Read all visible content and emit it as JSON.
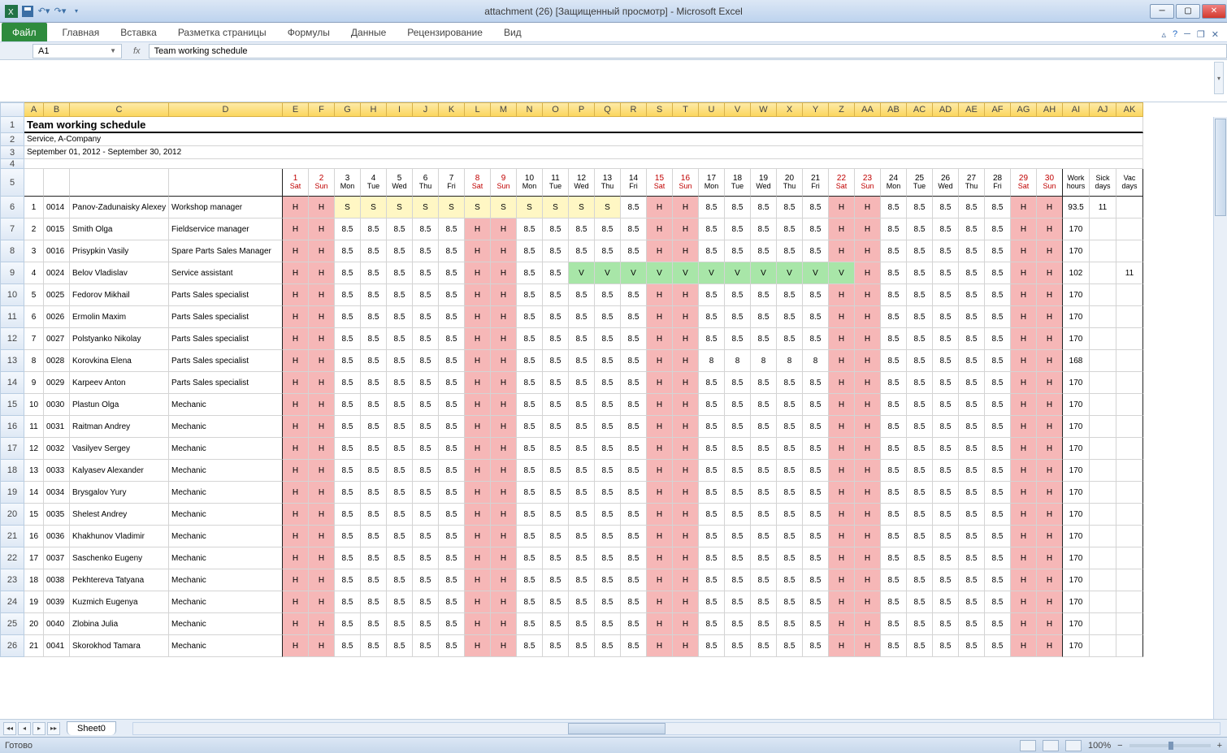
{
  "window": {
    "title": "attachment (26)  [Защищенный просмотр]  -  Microsoft Excel"
  },
  "ribbon": {
    "file": "Файл",
    "tabs": [
      "Главная",
      "Вставка",
      "Разметка страницы",
      "Формулы",
      "Данные",
      "Рецензирование",
      "Вид"
    ]
  },
  "namebox": "A1",
  "formula_value": "Team working schedule",
  "sheet_tab": "Sheet0",
  "status": {
    "ready": "Готово",
    "zoom": "100%"
  },
  "zoom_buttons": {
    "minus": "−",
    "plus": "+"
  },
  "col_widths": {
    "A": 24,
    "B": 32,
    "C": 122,
    "D": 140,
    "day": 32,
    "summary": 33
  },
  "col_letters": [
    "A",
    "B",
    "C",
    "D",
    "E",
    "F",
    "G",
    "H",
    "I",
    "J",
    "K",
    "L",
    "M",
    "N",
    "O",
    "P",
    "Q",
    "R",
    "S",
    "T",
    "U",
    "V",
    "W",
    "X",
    "Y",
    "Z",
    "AA",
    "AB",
    "AC",
    "AD",
    "AE",
    "AF",
    "AG",
    "AH",
    "AI",
    "AJ",
    "AK"
  ],
  "title_row": "Team working schedule",
  "subtitle": "Service, A-Company",
  "daterange": "September 01, 2012 - September 30, 2012",
  "days": [
    {
      "n": "1",
      "w": "Sat",
      "we": true
    },
    {
      "n": "2",
      "w": "Sun",
      "we": true
    },
    {
      "n": "3",
      "w": "Mon"
    },
    {
      "n": "4",
      "w": "Tue"
    },
    {
      "n": "5",
      "w": "Wed"
    },
    {
      "n": "6",
      "w": "Thu"
    },
    {
      "n": "7",
      "w": "Fri"
    },
    {
      "n": "8",
      "w": "Sat",
      "we": true
    },
    {
      "n": "9",
      "w": "Sun",
      "we": true
    },
    {
      "n": "10",
      "w": "Mon"
    },
    {
      "n": "11",
      "w": "Tue"
    },
    {
      "n": "12",
      "w": "Wed"
    },
    {
      "n": "13",
      "w": "Thu"
    },
    {
      "n": "14",
      "w": "Fri"
    },
    {
      "n": "15",
      "w": "Sat",
      "we": true
    },
    {
      "n": "16",
      "w": "Sun",
      "we": true
    },
    {
      "n": "17",
      "w": "Mon"
    },
    {
      "n": "18",
      "w": "Tue"
    },
    {
      "n": "19",
      "w": "Wed"
    },
    {
      "n": "20",
      "w": "Thu"
    },
    {
      "n": "21",
      "w": "Fri"
    },
    {
      "n": "22",
      "w": "Sat",
      "we": true
    },
    {
      "n": "23",
      "w": "Sun",
      "we": true
    },
    {
      "n": "24",
      "w": "Mon"
    },
    {
      "n": "25",
      "w": "Tue"
    },
    {
      "n": "26",
      "w": "Wed"
    },
    {
      "n": "27",
      "w": "Thu"
    },
    {
      "n": "28",
      "w": "Fri"
    },
    {
      "n": "29",
      "w": "Sat",
      "we": true
    },
    {
      "n": "30",
      "w": "Sun",
      "we": true
    }
  ],
  "summary_heads": [
    "Work\nhours",
    "Sick\ndays",
    "Vac\ndays"
  ],
  "rows": [
    {
      "idx": "1",
      "code": "0014",
      "name": "Panov-Zadunaisky Alexey",
      "role": "Workshop manager",
      "d": [
        "H",
        "H",
        "S",
        "S",
        "S",
        "S",
        "S",
        "S",
        "S",
        "S",
        "S",
        "S",
        "S",
        "8.5",
        "H",
        "H",
        "8.5",
        "8.5",
        "8.5",
        "8.5",
        "8.5",
        "H",
        "H",
        "8.5",
        "8.5",
        "8.5",
        "8.5",
        "8.5",
        "H",
        "H"
      ],
      "sum": [
        "93.5",
        "11",
        ""
      ]
    },
    {
      "idx": "2",
      "code": "0015",
      "name": "Smith Olga",
      "role": "Fieldservice manager",
      "d": [
        "H",
        "H",
        "8.5",
        "8.5",
        "8.5",
        "8.5",
        "8.5",
        "H",
        "H",
        "8.5",
        "8.5",
        "8.5",
        "8.5",
        "8.5",
        "H",
        "H",
        "8.5",
        "8.5",
        "8.5",
        "8.5",
        "8.5",
        "H",
        "H",
        "8.5",
        "8.5",
        "8.5",
        "8.5",
        "8.5",
        "H",
        "H"
      ],
      "sum": [
        "170",
        "",
        ""
      ]
    },
    {
      "idx": "3",
      "code": "0016",
      "name": "Prisypkin Vasily",
      "role": "Spare Parts Sales Manager",
      "d": [
        "H",
        "H",
        "8.5",
        "8.5",
        "8.5",
        "8.5",
        "8.5",
        "H",
        "H",
        "8.5",
        "8.5",
        "8.5",
        "8.5",
        "8.5",
        "H",
        "H",
        "8.5",
        "8.5",
        "8.5",
        "8.5",
        "8.5",
        "H",
        "H",
        "8.5",
        "8.5",
        "8.5",
        "8.5",
        "8.5",
        "H",
        "H"
      ],
      "sum": [
        "170",
        "",
        ""
      ]
    },
    {
      "idx": "4",
      "code": "0024",
      "name": "Belov Vladislav",
      "role": "Service assistant",
      "d": [
        "H",
        "H",
        "8.5",
        "8.5",
        "8.5",
        "8.5",
        "8.5",
        "H",
        "H",
        "8.5",
        "8.5",
        "V",
        "V",
        "V",
        "V",
        "V",
        "V",
        "V",
        "V",
        "V",
        "V",
        "V",
        "H",
        "8.5",
        "8.5",
        "8.5",
        "8.5",
        "8.5",
        "H",
        "H"
      ],
      "sum": [
        "102",
        "",
        "11"
      ]
    },
    {
      "idx": "5",
      "code": "0025",
      "name": "Fedorov Mikhail",
      "role": "Parts Sales specialist",
      "d": [
        "H",
        "H",
        "8.5",
        "8.5",
        "8.5",
        "8.5",
        "8.5",
        "H",
        "H",
        "8.5",
        "8.5",
        "8.5",
        "8.5",
        "8.5",
        "H",
        "H",
        "8.5",
        "8.5",
        "8.5",
        "8.5",
        "8.5",
        "H",
        "H",
        "8.5",
        "8.5",
        "8.5",
        "8.5",
        "8.5",
        "H",
        "H"
      ],
      "sum": [
        "170",
        "",
        ""
      ]
    },
    {
      "idx": "6",
      "code": "0026",
      "name": "Ermolin Maxim",
      "role": "Parts Sales specialist",
      "d": [
        "H",
        "H",
        "8.5",
        "8.5",
        "8.5",
        "8.5",
        "8.5",
        "H",
        "H",
        "8.5",
        "8.5",
        "8.5",
        "8.5",
        "8.5",
        "H",
        "H",
        "8.5",
        "8.5",
        "8.5",
        "8.5",
        "8.5",
        "H",
        "H",
        "8.5",
        "8.5",
        "8.5",
        "8.5",
        "8.5",
        "H",
        "H"
      ],
      "sum": [
        "170",
        "",
        ""
      ]
    },
    {
      "idx": "7",
      "code": "0027",
      "name": "Polstyanko Nikolay",
      "role": "Parts Sales specialist",
      "d": [
        "H",
        "H",
        "8.5",
        "8.5",
        "8.5",
        "8.5",
        "8.5",
        "H",
        "H",
        "8.5",
        "8.5",
        "8.5",
        "8.5",
        "8.5",
        "H",
        "H",
        "8.5",
        "8.5",
        "8.5",
        "8.5",
        "8.5",
        "H",
        "H",
        "8.5",
        "8.5",
        "8.5",
        "8.5",
        "8.5",
        "H",
        "H"
      ],
      "sum": [
        "170",
        "",
        ""
      ]
    },
    {
      "idx": "8",
      "code": "0028",
      "name": "Korovkina Elena",
      "role": "Parts Sales specialist",
      "d": [
        "H",
        "H",
        "8.5",
        "8.5",
        "8.5",
        "8.5",
        "8.5",
        "H",
        "H",
        "8.5",
        "8.5",
        "8.5",
        "8.5",
        "8.5",
        "H",
        "H",
        "8",
        "8",
        "8",
        "8",
        "8",
        "H",
        "H",
        "8.5",
        "8.5",
        "8.5",
        "8.5",
        "8.5",
        "H",
        "H"
      ],
      "sum": [
        "168",
        "",
        ""
      ]
    },
    {
      "idx": "9",
      "code": "0029",
      "name": "Karpeev Anton",
      "role": "Parts Sales specialist",
      "d": [
        "H",
        "H",
        "8.5",
        "8.5",
        "8.5",
        "8.5",
        "8.5",
        "H",
        "H",
        "8.5",
        "8.5",
        "8.5",
        "8.5",
        "8.5",
        "H",
        "H",
        "8.5",
        "8.5",
        "8.5",
        "8.5",
        "8.5",
        "H",
        "H",
        "8.5",
        "8.5",
        "8.5",
        "8.5",
        "8.5",
        "H",
        "H"
      ],
      "sum": [
        "170",
        "",
        ""
      ]
    },
    {
      "idx": "10",
      "code": "0030",
      "name": "Plastun Olga",
      "role": "Mechanic",
      "d": [
        "H",
        "H",
        "8.5",
        "8.5",
        "8.5",
        "8.5",
        "8.5",
        "H",
        "H",
        "8.5",
        "8.5",
        "8.5",
        "8.5",
        "8.5",
        "H",
        "H",
        "8.5",
        "8.5",
        "8.5",
        "8.5",
        "8.5",
        "H",
        "H",
        "8.5",
        "8.5",
        "8.5",
        "8.5",
        "8.5",
        "H",
        "H"
      ],
      "sum": [
        "170",
        "",
        ""
      ]
    },
    {
      "idx": "11",
      "code": "0031",
      "name": "Raitman Andrey",
      "role": "Mechanic",
      "d": [
        "H",
        "H",
        "8.5",
        "8.5",
        "8.5",
        "8.5",
        "8.5",
        "H",
        "H",
        "8.5",
        "8.5",
        "8.5",
        "8.5",
        "8.5",
        "H",
        "H",
        "8.5",
        "8.5",
        "8.5",
        "8.5",
        "8.5",
        "H",
        "H",
        "8.5",
        "8.5",
        "8.5",
        "8.5",
        "8.5",
        "H",
        "H"
      ],
      "sum": [
        "170",
        "",
        ""
      ]
    },
    {
      "idx": "12",
      "code": "0032",
      "name": "Vasilyev Sergey",
      "role": "Mechanic",
      "d": [
        "H",
        "H",
        "8.5",
        "8.5",
        "8.5",
        "8.5",
        "8.5",
        "H",
        "H",
        "8.5",
        "8.5",
        "8.5",
        "8.5",
        "8.5",
        "H",
        "H",
        "8.5",
        "8.5",
        "8.5",
        "8.5",
        "8.5",
        "H",
        "H",
        "8.5",
        "8.5",
        "8.5",
        "8.5",
        "8.5",
        "H",
        "H"
      ],
      "sum": [
        "170",
        "",
        ""
      ]
    },
    {
      "idx": "13",
      "code": "0033",
      "name": "Kalyasev Alexander",
      "role": "Mechanic",
      "d": [
        "H",
        "H",
        "8.5",
        "8.5",
        "8.5",
        "8.5",
        "8.5",
        "H",
        "H",
        "8.5",
        "8.5",
        "8.5",
        "8.5",
        "8.5",
        "H",
        "H",
        "8.5",
        "8.5",
        "8.5",
        "8.5",
        "8.5",
        "H",
        "H",
        "8.5",
        "8.5",
        "8.5",
        "8.5",
        "8.5",
        "H",
        "H"
      ],
      "sum": [
        "170",
        "",
        ""
      ]
    },
    {
      "idx": "14",
      "code": "0034",
      "name": "Brysgalov Yury",
      "role": "Mechanic",
      "d": [
        "H",
        "H",
        "8.5",
        "8.5",
        "8.5",
        "8.5",
        "8.5",
        "H",
        "H",
        "8.5",
        "8.5",
        "8.5",
        "8.5",
        "8.5",
        "H",
        "H",
        "8.5",
        "8.5",
        "8.5",
        "8.5",
        "8.5",
        "H",
        "H",
        "8.5",
        "8.5",
        "8.5",
        "8.5",
        "8.5",
        "H",
        "H"
      ],
      "sum": [
        "170",
        "",
        ""
      ]
    },
    {
      "idx": "15",
      "code": "0035",
      "name": "Shelest Andrey",
      "role": "Mechanic",
      "d": [
        "H",
        "H",
        "8.5",
        "8.5",
        "8.5",
        "8.5",
        "8.5",
        "H",
        "H",
        "8.5",
        "8.5",
        "8.5",
        "8.5",
        "8.5",
        "H",
        "H",
        "8.5",
        "8.5",
        "8.5",
        "8.5",
        "8.5",
        "H",
        "H",
        "8.5",
        "8.5",
        "8.5",
        "8.5",
        "8.5",
        "H",
        "H"
      ],
      "sum": [
        "170",
        "",
        ""
      ]
    },
    {
      "idx": "16",
      "code": "0036",
      "name": "Khakhunov Vladimir",
      "role": "Mechanic",
      "d": [
        "H",
        "H",
        "8.5",
        "8.5",
        "8.5",
        "8.5",
        "8.5",
        "H",
        "H",
        "8.5",
        "8.5",
        "8.5",
        "8.5",
        "8.5",
        "H",
        "H",
        "8.5",
        "8.5",
        "8.5",
        "8.5",
        "8.5",
        "H",
        "H",
        "8.5",
        "8.5",
        "8.5",
        "8.5",
        "8.5",
        "H",
        "H"
      ],
      "sum": [
        "170",
        "",
        ""
      ]
    },
    {
      "idx": "17",
      "code": "0037",
      "name": "Saschenko Eugeny",
      "role": "Mechanic",
      "d": [
        "H",
        "H",
        "8.5",
        "8.5",
        "8.5",
        "8.5",
        "8.5",
        "H",
        "H",
        "8.5",
        "8.5",
        "8.5",
        "8.5",
        "8.5",
        "H",
        "H",
        "8.5",
        "8.5",
        "8.5",
        "8.5",
        "8.5",
        "H",
        "H",
        "8.5",
        "8.5",
        "8.5",
        "8.5",
        "8.5",
        "H",
        "H"
      ],
      "sum": [
        "170",
        "",
        ""
      ]
    },
    {
      "idx": "18",
      "code": "0038",
      "name": "Pekhtereva Tatyana",
      "role": "Mechanic",
      "d": [
        "H",
        "H",
        "8.5",
        "8.5",
        "8.5",
        "8.5",
        "8.5",
        "H",
        "H",
        "8.5",
        "8.5",
        "8.5",
        "8.5",
        "8.5",
        "H",
        "H",
        "8.5",
        "8.5",
        "8.5",
        "8.5",
        "8.5",
        "H",
        "H",
        "8.5",
        "8.5",
        "8.5",
        "8.5",
        "8.5",
        "H",
        "H"
      ],
      "sum": [
        "170",
        "",
        ""
      ]
    },
    {
      "idx": "19",
      "code": "0039",
      "name": "Kuzmich Eugenya",
      "role": "Mechanic",
      "d": [
        "H",
        "H",
        "8.5",
        "8.5",
        "8.5",
        "8.5",
        "8.5",
        "H",
        "H",
        "8.5",
        "8.5",
        "8.5",
        "8.5",
        "8.5",
        "H",
        "H",
        "8.5",
        "8.5",
        "8.5",
        "8.5",
        "8.5",
        "H",
        "H",
        "8.5",
        "8.5",
        "8.5",
        "8.5",
        "8.5",
        "H",
        "H"
      ],
      "sum": [
        "170",
        "",
        ""
      ]
    },
    {
      "idx": "20",
      "code": "0040",
      "name": "Zlobina Julia",
      "role": "Mechanic",
      "d": [
        "H",
        "H",
        "8.5",
        "8.5",
        "8.5",
        "8.5",
        "8.5",
        "H",
        "H",
        "8.5",
        "8.5",
        "8.5",
        "8.5",
        "8.5",
        "H",
        "H",
        "8.5",
        "8.5",
        "8.5",
        "8.5",
        "8.5",
        "H",
        "H",
        "8.5",
        "8.5",
        "8.5",
        "8.5",
        "8.5",
        "H",
        "H"
      ],
      "sum": [
        "170",
        "",
        ""
      ]
    },
    {
      "idx": "21",
      "code": "0041",
      "name": "Skorokhod Tamara",
      "role": "Mechanic",
      "d": [
        "H",
        "H",
        "8.5",
        "8.5",
        "8.5",
        "8.5",
        "8.5",
        "H",
        "H",
        "8.5",
        "8.5",
        "8.5",
        "8.5",
        "8.5",
        "H",
        "H",
        "8.5",
        "8.5",
        "8.5",
        "8.5",
        "8.5",
        "H",
        "H",
        "8.5",
        "8.5",
        "8.5",
        "8.5",
        "8.5",
        "H",
        "H"
      ],
      "sum": [
        "170",
        "",
        ""
      ]
    }
  ]
}
